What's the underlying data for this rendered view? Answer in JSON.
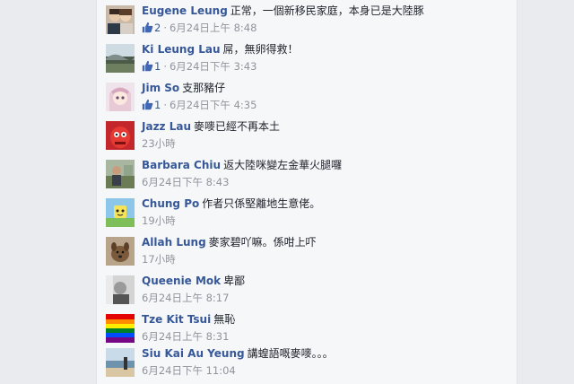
{
  "comments": [
    {
      "name": "Eugene Leung",
      "text": "正常，一個新移民家庭，本身已是大陸豚",
      "likes": "2",
      "time": "6月24日上午 8:48",
      "avatar": "avatar-couple-photo"
    },
    {
      "name": "Ki Leung Lau",
      "text": "屌，無卵得救！",
      "likes": "1",
      "time": "6月24日下午 3:43",
      "avatar": "avatar-landscape-photo"
    },
    {
      "name": "Jim So",
      "text": "支那豬仔",
      "likes": "1",
      "time": "6月24日下午 4:35",
      "avatar": "avatar-anime-girl"
    },
    {
      "name": "Jazz Lau",
      "text": "麥嘜已經不再本土",
      "likes": "",
      "time": "23小時",
      "avatar": "avatar-red-cartoon"
    },
    {
      "name": "Barbara Chiu",
      "text": "返大陸咪變左金華火腿囉",
      "likes": "",
      "time": "6月24日下午 8:43",
      "avatar": "avatar-outdoor-photo"
    },
    {
      "name": "Chung Po",
      "text": "作者只係堅離地生意佬。",
      "likes": "",
      "time": "19小時",
      "avatar": "avatar-cartoon-character"
    },
    {
      "name": "Allah Lung",
      "text": "麥家碧吖嘛。係咁上吓",
      "likes": "",
      "time": "17小時",
      "avatar": "avatar-dog-photo"
    },
    {
      "name": "Queenie Mok",
      "text": "卑鄙",
      "likes": "",
      "time": "6月24日上午 8:17",
      "avatar": "avatar-bw-photo"
    },
    {
      "name": "Tze Kit Tsui",
      "text": "無恥",
      "likes": "",
      "time": "6月24日上午 8:31",
      "avatar": "avatar-rainbow-flag"
    },
    {
      "name": "Siu Kai Au Yeung",
      "text": "講蝗語嘅麥嘜。。。",
      "likes": "",
      "time": "6月24日下午 11:04",
      "avatar": "avatar-beach-photo"
    }
  ],
  "colors": {
    "name": "#365899",
    "meta": "#90949c",
    "text": "#1d2129",
    "panel": "#f6f7f9"
  }
}
